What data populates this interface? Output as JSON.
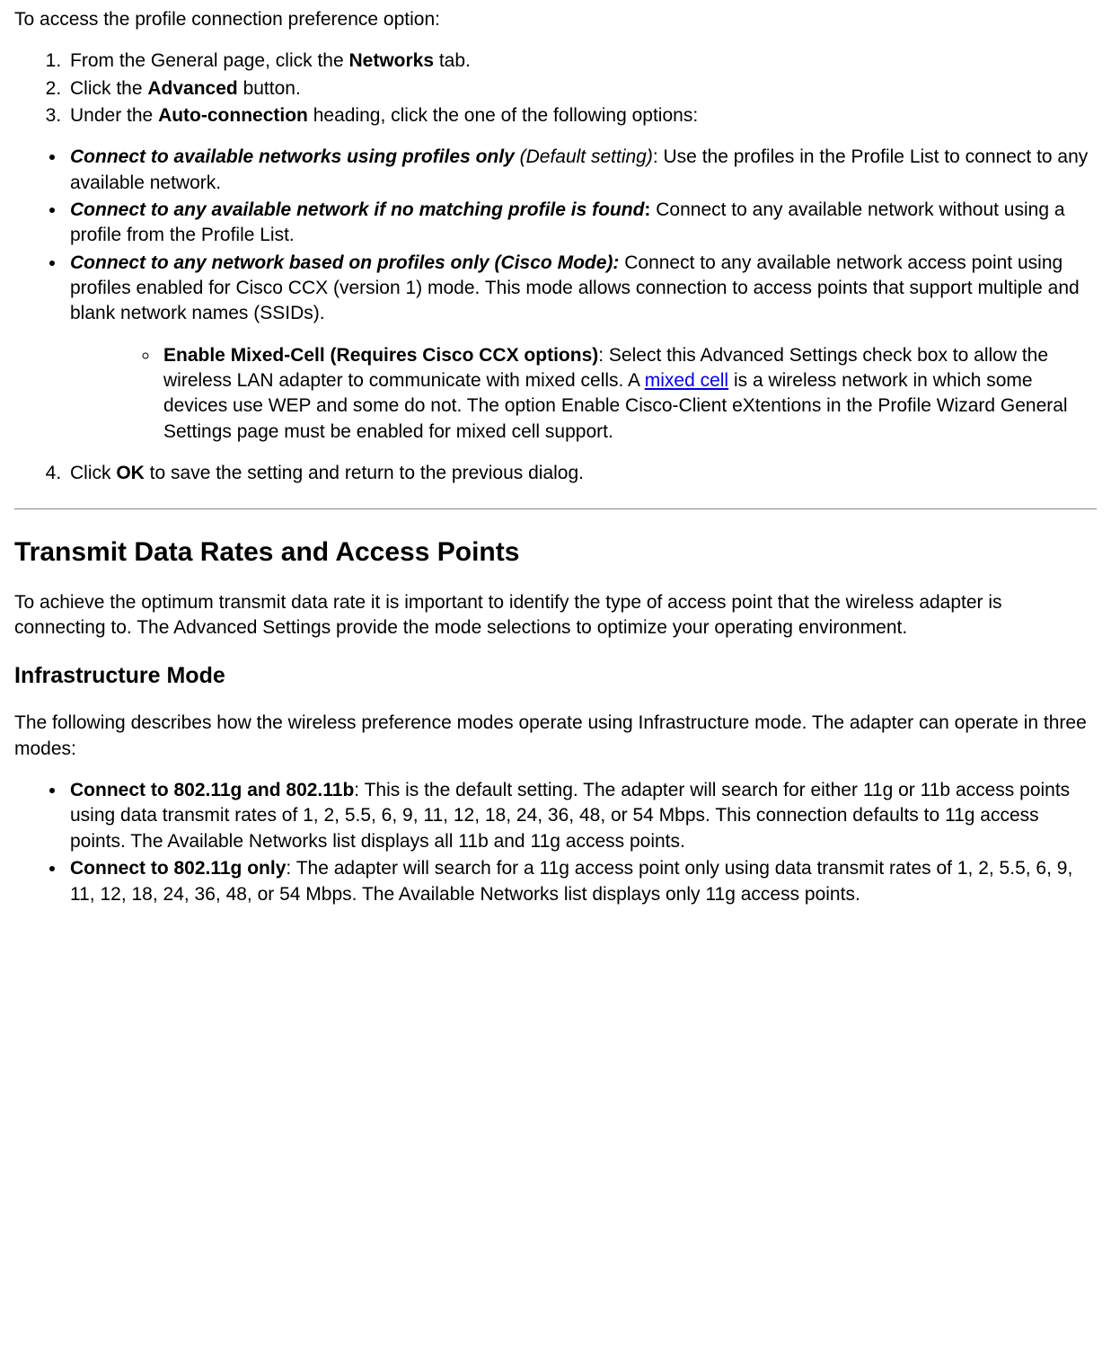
{
  "intro": "To access the profile connection preference option:",
  "steps": {
    "s1_a": "From the General page, click the ",
    "s1_b": "Networks",
    "s1_c": " tab.",
    "s2_a": "Click the ",
    "s2_b": "Advanced",
    "s2_c": " button.",
    "s3_a": "Under the ",
    "s3_b": "Auto-connection",
    "s3_c": " heading, click the one of the following options:",
    "s4_a": "Click ",
    "s4_b": "OK",
    "s4_c": " to save the setting and return to the previous dialog."
  },
  "opts": {
    "o1_t": "Connect to available networks using profiles only",
    "o1_d": " (Default setting)",
    "o1_r": ": Use the profiles in the Profile List to connect to any available network.",
    "o2_t": "Connect to any available network if no matching profile is found",
    "o2_c": ": ",
    "o2_r": "Connect to any available network without using a profile from the Profile List.",
    "o3_t": "Connect to any network based on profiles only (Cisco Mode):",
    "o3_r": "  Connect to any available network access point using profiles enabled for Cisco CCX (version 1) mode. This mode allows connection to access points that support multiple and blank network names (SSIDs)."
  },
  "sub": {
    "t": "Enable Mixed-Cell (Requires Cisco CCX options)",
    "a": ": Select this Advanced Settings check box to allow the wireless LAN adapter to communicate with mixed cells. A ",
    "link": "mixed cell",
    "b": " is a wireless network in which some devices use WEP and some do not. The option Enable Cisco-Client eXtentions in the Profile Wizard General Settings page must be enabled for mixed cell support."
  },
  "tx": {
    "heading": "Transmit Data Rates and Access Points",
    "intro": "To achieve the optimum transmit data rate it is important to identify the type of access point that the wireless adapter is connecting to. The Advanced Settings provide the mode selections to optimize your operating environment.",
    "infra_h": "Infrastructure Mode",
    "infra_p": "The following describes how the wireless preference modes operate using Infrastructure mode. The adapter can operate in three modes:",
    "m1_t": "Connect to 802.11g and 802.11b",
    "m1_r": ": This is the default setting. The adapter will search for either 11g or 11b access points using data transmit rates of 1, 2, 5.5, 6, 9, 11, 12, 18, 24, 36, 48, or 54 Mbps. This connection defaults to 11g access points. The Available Networks list displays all 11b and 11g access points.",
    "m2_t": "Connect to 802.11g only",
    "m2_r": ": The adapter will search for a 11g access point only using data transmit rates of 1, 2, 5.5, 6, 9, 11, 12, 18, 24, 36, 48, or 54 Mbps. The Available Networks list displays only 11g access points."
  }
}
